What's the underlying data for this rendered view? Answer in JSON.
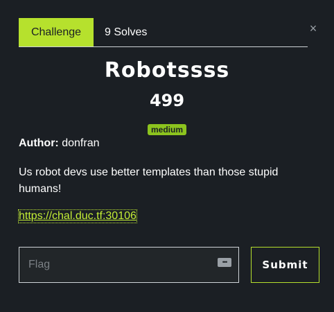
{
  "tabs": {
    "challenge_label": "Challenge",
    "solves_label": "9 Solves"
  },
  "close_icon": "×",
  "challenge": {
    "name": "Robotssss",
    "points": "499",
    "difficulty": "medium",
    "author_label": "Author:",
    "author": "donfran",
    "description": "Us robot devs use better templates than those stupid humans!",
    "link": "https://chal.duc.tf:30106"
  },
  "form": {
    "flag_placeholder": "Flag",
    "submit_label": "Submit",
    "password_manager_icon": "key-icon"
  },
  "colors": {
    "accent": "#b6e12d",
    "badge": "#8cc31e",
    "background": "#1b1f24",
    "link": "#c4ef35"
  }
}
